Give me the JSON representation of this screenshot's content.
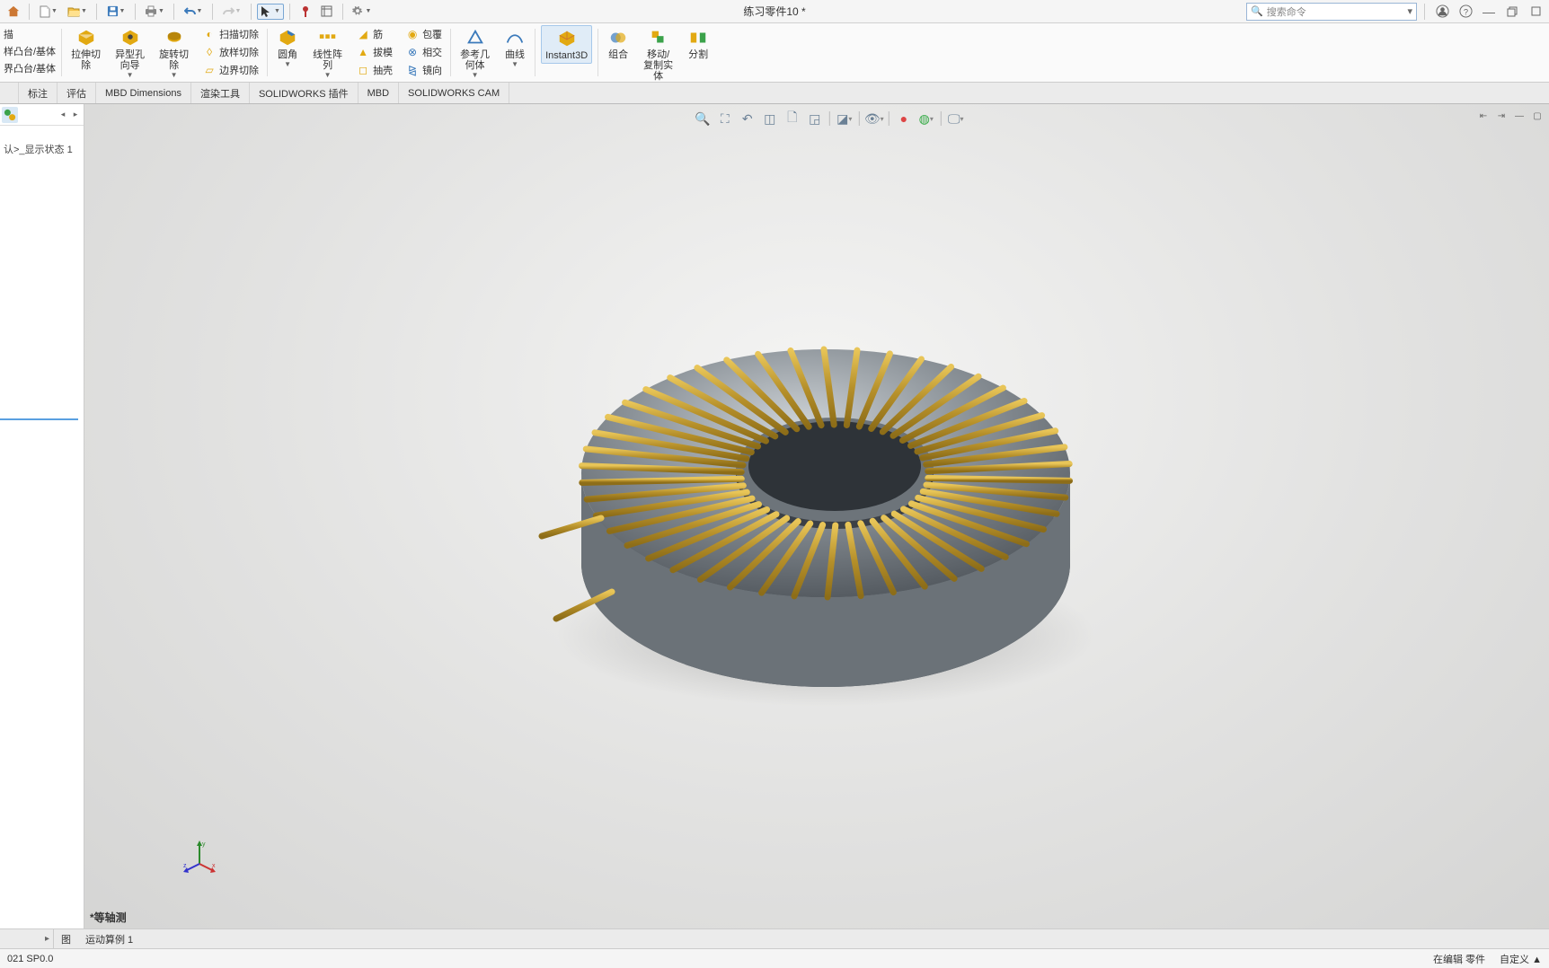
{
  "menubar": {
    "title": "练习零件10 *",
    "search_placeholder": "搜索命令"
  },
  "ribbon": {
    "edge_items": [
      "描",
      "样凸台/基体",
      "界凸台/基体"
    ],
    "extrude_cut": "拉伸切\n除",
    "hole_wizard": "异型孔\n向导",
    "revolve_cut": "旋转切\n除",
    "swept_cut": "扫描切除",
    "lofted_cut": "放样切除",
    "boundary_cut": "边界切除",
    "fillet": "圆角",
    "linear_pattern": "线性阵\n列",
    "rib": "筋",
    "draft": "拔模",
    "shell": "抽壳",
    "wrap": "包覆",
    "intersect": "相交",
    "mirror": "镜向",
    "ref_geom": "参考几\n何体",
    "curves": "曲线",
    "instant3d": "Instant3D",
    "combine": "组合",
    "move_copy": "移动/\n复制实\n体",
    "split": "分割"
  },
  "tabs": {
    "items": [
      "",
      "标注",
      "评估",
      "MBD Dimensions",
      "渲染工具",
      "SOLIDWORKS 插件",
      "MBD",
      "SOLIDWORKS CAM"
    ]
  },
  "feature_panel": {
    "display_state": "认>_显示状态 1"
  },
  "bottom_tabs": {
    "model": "图",
    "motion": "运动算例 1",
    "view_label": "*等轴测"
  },
  "status": {
    "version": "021 SP0.0",
    "editing": "在编辑 零件",
    "custom": "自定义",
    "arrow": "▲"
  },
  "triad_labels": {
    "x": "x",
    "y": "y",
    "z": "z"
  }
}
